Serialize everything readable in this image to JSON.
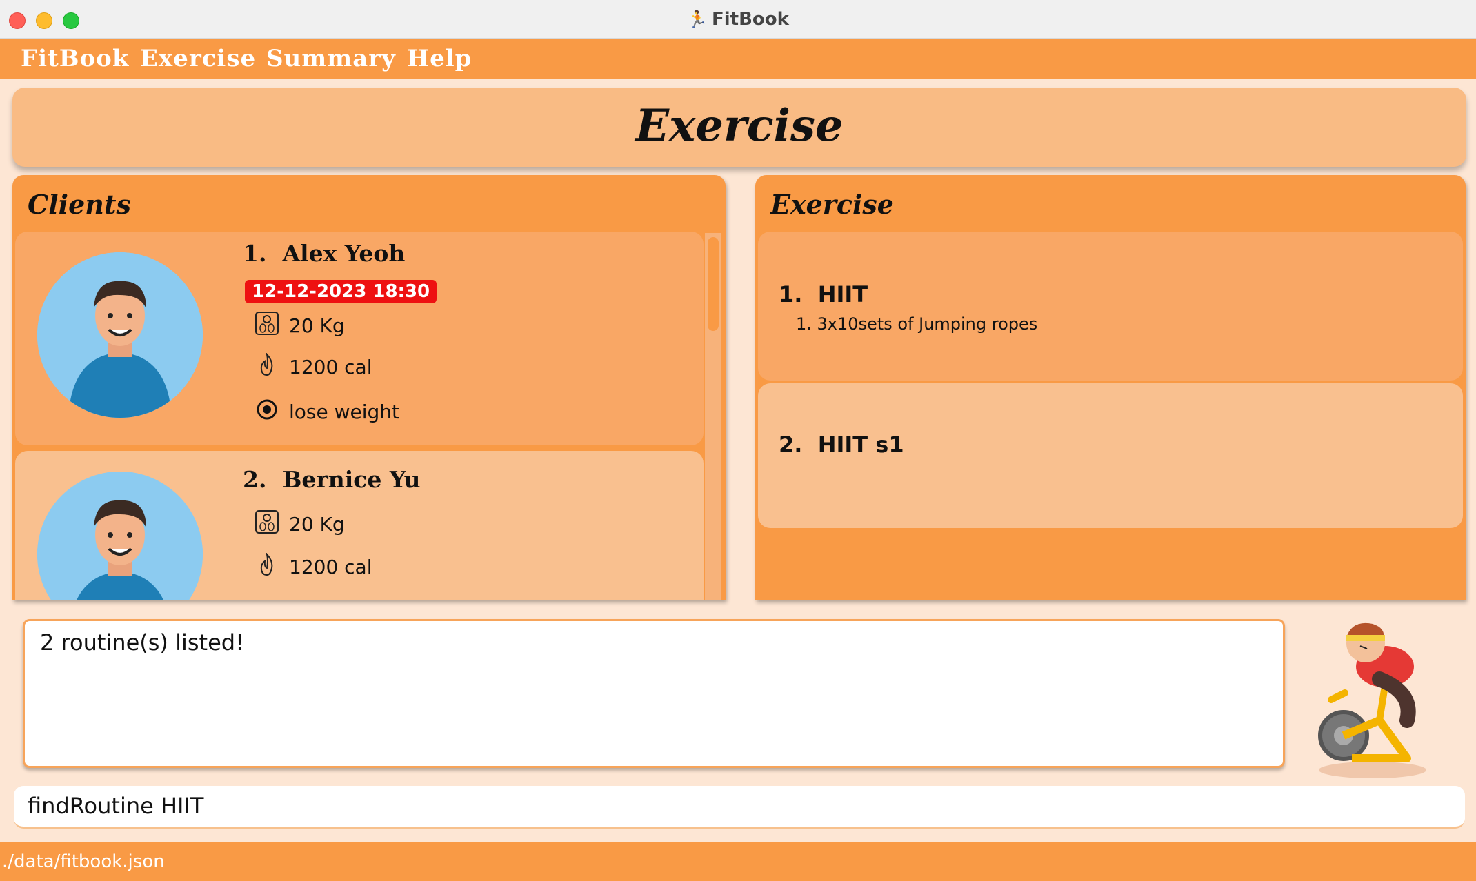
{
  "window": {
    "title": "FitBook"
  },
  "menu": {
    "items": [
      "FitBook",
      "Exercise",
      "Summary",
      "Help"
    ]
  },
  "header": {
    "title": "Exercise"
  },
  "clients": {
    "title": "Clients",
    "items": [
      {
        "index": "1.",
        "name": "Alex Yeoh",
        "appointment": "12-12-2023 18:30",
        "weight": "20 Kg",
        "calories": "1200 cal",
        "goal": "lose weight"
      },
      {
        "index": "2.",
        "name": "Bernice Yu",
        "weight": "20 Kg",
        "calories": "1200 cal"
      }
    ]
  },
  "exercise": {
    "title": "Exercise",
    "routines": [
      {
        "index": "1.",
        "name": "HIIT",
        "exercises": [
          "1. 3x10sets of Jumping ropes"
        ]
      },
      {
        "index": "2.",
        "name": "HIIT s1",
        "exercises": []
      }
    ]
  },
  "result": {
    "text": "2 routine(s) listed!"
  },
  "command": {
    "value": "findRoutine HIIT"
  },
  "status": {
    "path": "./data/fitbook.json"
  },
  "colors": {
    "accent": "#f99a45",
    "light": "#f9bb84",
    "badge": "#ee1111",
    "avatar_bg": "#8ccbf0"
  },
  "icons": {
    "weight": "scale-icon",
    "calories": "flame-icon",
    "goal": "target-icon"
  }
}
